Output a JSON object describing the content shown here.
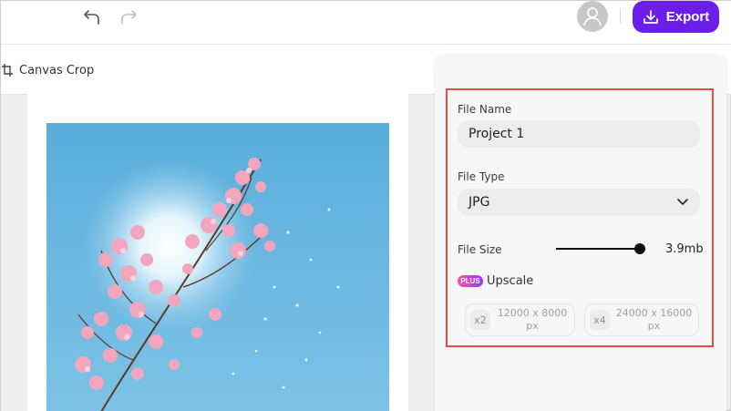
{
  "toolbar": {
    "undo_icon": "undo-icon",
    "redo_icon": "redo-icon",
    "avatar_icon": "user-icon",
    "export_label": "Export",
    "export_icon": "download-icon",
    "accent": "#6a1ee8"
  },
  "subbar": {
    "crop_label": "Canvas Crop",
    "crop_icon": "crop-icon"
  },
  "export_panel": {
    "file_name_label": "File Name",
    "file_name_value": "Project 1",
    "file_type_label": "File Type",
    "file_type_value": "JPG",
    "file_size_label": "File Size",
    "file_size_value": "3.9mb",
    "file_size_slider_fraction": 0.93,
    "plus_badge": "PLUS",
    "upscale_label": "Upscale",
    "upscale_options": [
      {
        "multiplier": "x2",
        "dims": "12000 x 8000",
        "unit": "px"
      },
      {
        "multiplier": "x4",
        "dims": "24000 x 16000",
        "unit": "px"
      }
    ],
    "highlight_color": "#e74b43"
  }
}
